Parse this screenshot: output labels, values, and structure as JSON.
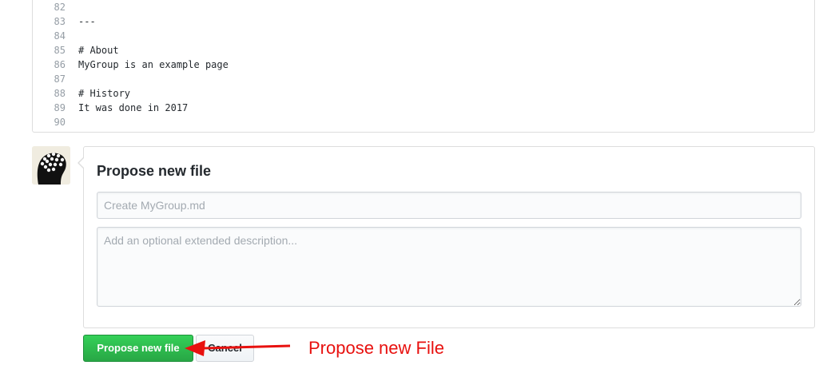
{
  "editor": {
    "lines": [
      {
        "num": "82",
        "text": ""
      },
      {
        "num": "83",
        "text": "---"
      },
      {
        "num": "84",
        "text": ""
      },
      {
        "num": "85",
        "text": "# About"
      },
      {
        "num": "86",
        "text": "MyGroup is an example page"
      },
      {
        "num": "87",
        "text": ""
      },
      {
        "num": "88",
        "text": "# History"
      },
      {
        "num": "89",
        "text": "It was done in 2017"
      },
      {
        "num": "90",
        "text": ""
      }
    ]
  },
  "commit": {
    "title": "Propose new file",
    "summary_placeholder": "Create MyGroup.md",
    "summary_value": "",
    "description_placeholder": "Add an optional extended description...",
    "description_value": ""
  },
  "actions": {
    "submit_label": "Propose new file",
    "cancel_label": "Cancel"
  },
  "annotation": {
    "text": "Propose new File",
    "color": "#e8110f"
  },
  "colors": {
    "primary_button": "#28a745",
    "annotation": "#e8110f"
  },
  "icons": {
    "avatar": "user-avatar"
  }
}
